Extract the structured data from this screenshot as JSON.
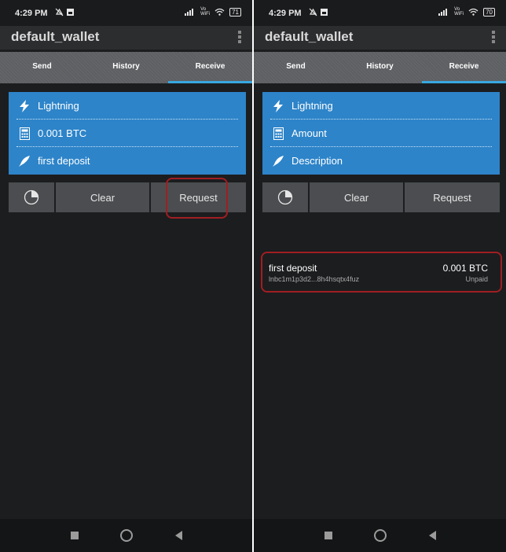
{
  "left_screen": {
    "status": {
      "time": "4:29 PM",
      "wifi_label": "Vo WiFi",
      "battery": "71"
    },
    "title": "default_wallet",
    "tabs": [
      {
        "label": "Send"
      },
      {
        "label": "History"
      },
      {
        "label": "Receive"
      }
    ],
    "form": {
      "type": "Lightning",
      "amount": "0.001 BTC",
      "description": "first deposit"
    },
    "buttons": {
      "clear": "Clear",
      "request": "Request"
    }
  },
  "right_screen": {
    "status": {
      "time": "4:29 PM",
      "wifi_label": "Vo WiFi",
      "battery": "70"
    },
    "title": "default_wallet",
    "tabs": [
      {
        "label": "Send"
      },
      {
        "label": "History"
      },
      {
        "label": "Receive"
      }
    ],
    "form": {
      "type": "Lightning",
      "amount_placeholder": "Amount",
      "description_placeholder": "Description"
    },
    "buttons": {
      "clear": "Clear",
      "request": "Request"
    },
    "request_item": {
      "description": "first deposit",
      "address": "lnbc1m1p3d2...8h4hsqtx4fuz",
      "amount": "0.001 BTC",
      "status": "Unpaid"
    }
  },
  "colors": {
    "accent": "#2d84c9",
    "highlight": "#a01e22",
    "tab_underline": "#39a8df"
  }
}
